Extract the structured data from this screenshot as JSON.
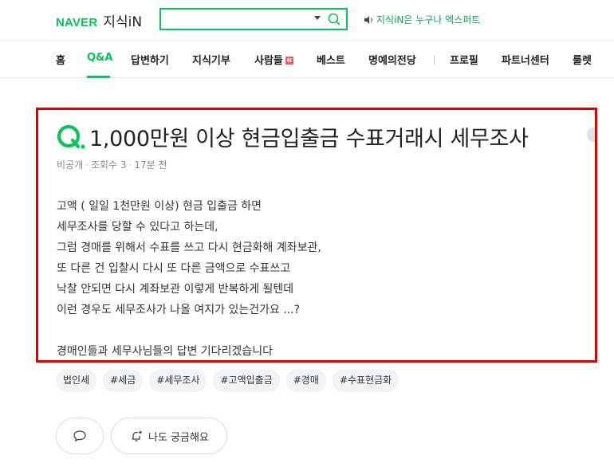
{
  "header": {
    "brand": "NAVER",
    "service": "지식iN",
    "search_value": "",
    "banner": "지식iN은 누구나 엑스퍼트"
  },
  "nav": {
    "items": [
      {
        "label": "홈"
      },
      {
        "label": "Q&A",
        "active": true
      },
      {
        "label": "답변하기"
      },
      {
        "label": "지식기부"
      },
      {
        "label": "사람들",
        "badge": "N"
      },
      {
        "label": "베스트"
      },
      {
        "label": "명예의전당"
      },
      {
        "label": "프로필"
      },
      {
        "label": "파트너센터"
      },
      {
        "label": "룰렛"
      }
    ]
  },
  "question": {
    "title": "1,000만원 이상 현금입출금 수표거래시 세무조사",
    "author": "비공개",
    "views": "조회수 3",
    "time": "17분 전",
    "lines": [
      "고액 ( 일일 1천만원 이상) 현금 입출금 하면",
      "세무조사를 당할 수 있다고 하는데,",
      "그럼 경매를 위해서 수표를 쓰고 다시 현금화해 계좌보관,",
      "또 다른 건 입찰시 다시 또 다른 금액으로 수표쓰고",
      "낙찰 안되면 다시 계좌보관 이렇게 반복하게 될텐데",
      "이런 경우도 세무조사가 나올 여지가 있는건가요 ...?",
      "",
      "경매인들과 세무사님들의 답변 기다리겠습니다"
    ]
  },
  "tags": [
    "법인세",
    "#세금",
    "#세무조사",
    "#고액입출금",
    "#경매",
    "#수표현금화"
  ],
  "actions": {
    "curious_label": "나도 궁금해요"
  },
  "colors": {
    "brand_green": "#03c75a",
    "highlight_border": "#e00000"
  }
}
